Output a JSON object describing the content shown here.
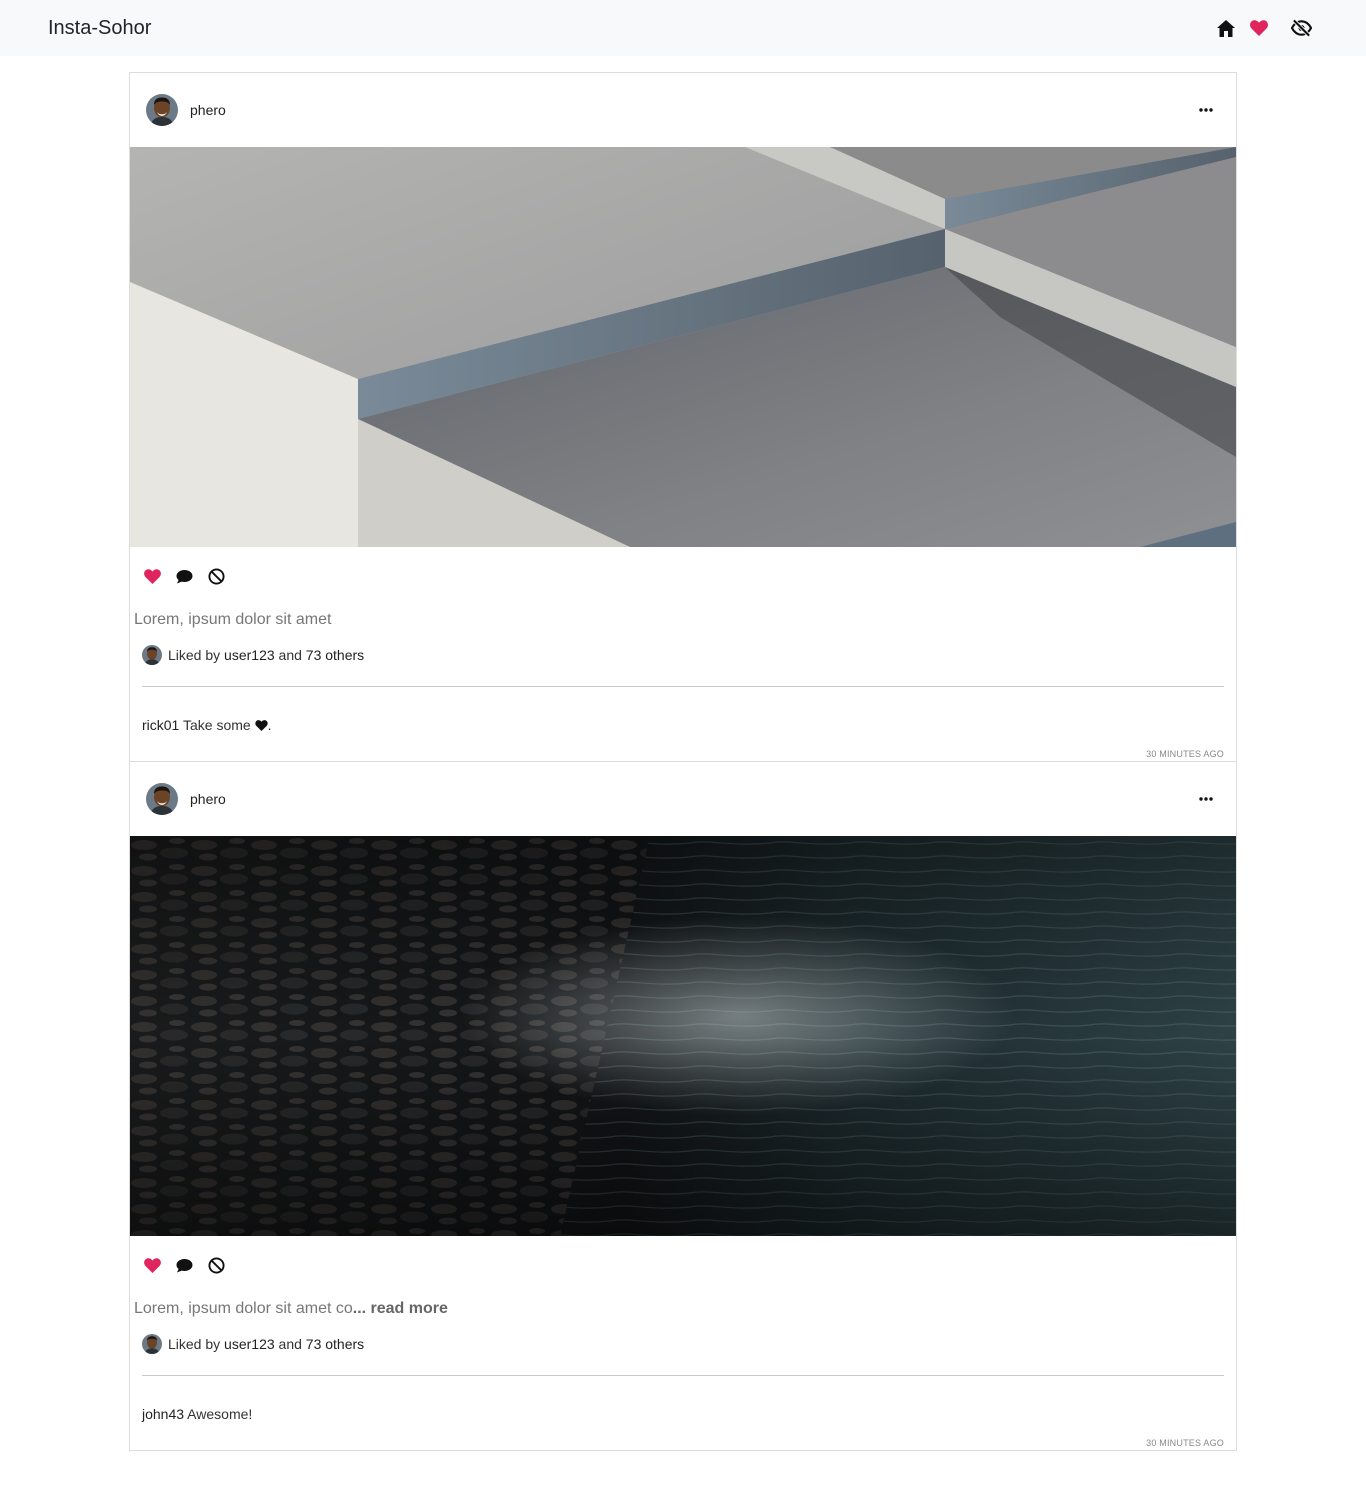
{
  "app": {
    "brand": "Insta-Sohor",
    "nav_icons": [
      "home-icon",
      "heart-icon",
      "eye-slash-icon"
    ],
    "accent_color": "#e0245e"
  },
  "posts": [
    {
      "username": "phero",
      "image": "abstract-grey-blocks",
      "caption": "Lorem, ipsum dolor sit amet",
      "read_more": "",
      "liked_by_prefix": "Liked by",
      "liked_user": "user123",
      "liked_and": "and",
      "liked_others": "73 others",
      "comment_user": "rick01",
      "comment_text": "Take some",
      "comment_suffix": ".",
      "timestamp": "30 MINUTES AGO"
    },
    {
      "username": "phero",
      "image": "dark-pebbles-water",
      "caption": "Lorem, ipsum dolor sit amet co",
      "read_more": "... read more",
      "liked_by_prefix": "Liked by",
      "liked_user": "user123",
      "liked_and": "and",
      "liked_others": "73 others",
      "comment_user": "john43",
      "comment_text": "Awesome!",
      "comment_suffix": "",
      "timestamp": "30 MINUTES AGO"
    }
  ]
}
